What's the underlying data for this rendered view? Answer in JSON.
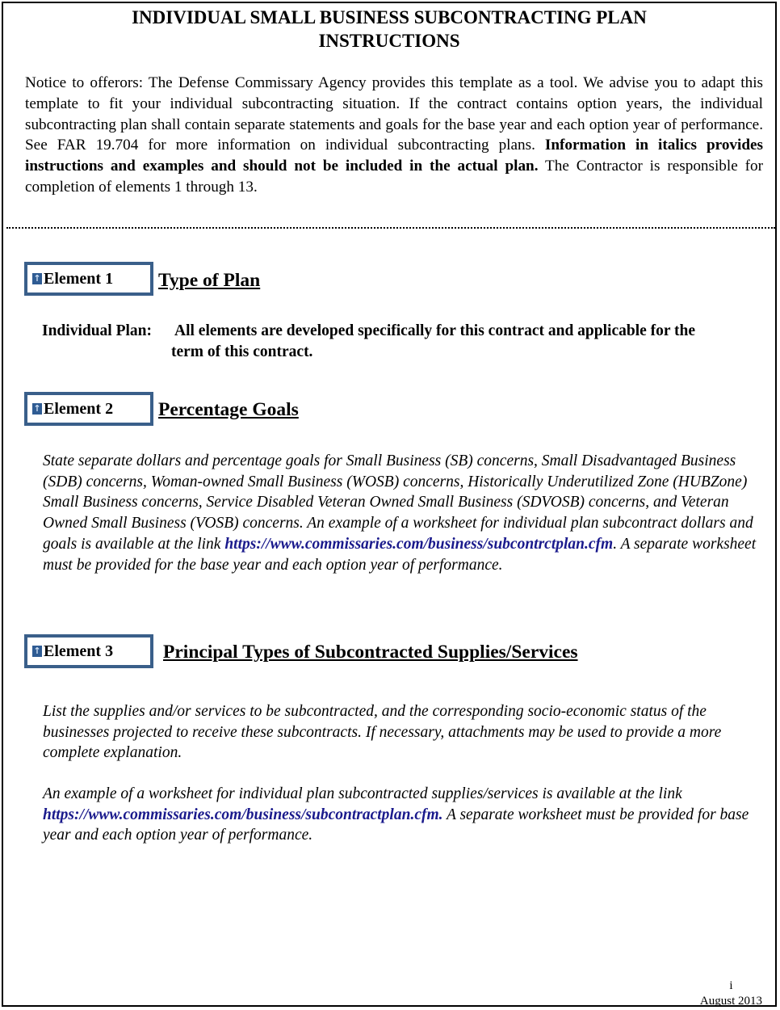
{
  "document": {
    "title_line1": "INDIVIDUAL SMALL BUSINESS  SUBCONTRACTING PLAN",
    "title_line2": "INSTRUCTIONS",
    "notice": {
      "text1": "Notice to offerors:  The Defense Commissary Agency provides this template as a tool.  We advise you to adapt this template to fit your individual subcontracting situation. If the contract contains option years, the individual subcontracting plan shall contain separate statements and goals for the base year and each option year of performance.  See FAR 19.704 for more information on individual subcontracting plans. ",
      "bold": "Information in italics provides instructions and examples and should not be included in the actual plan.",
      "text2": "  The Contractor is responsible for completion of elements 1 through 13."
    },
    "elements": [
      {
        "label": "Element 1",
        "heading": "Type of Plan",
        "plan_label": "Individual Plan:",
        "plan_text_line1": "All elements are developed specifically for this contract and applicable for the",
        "plan_text_line2": "term of this contract."
      },
      {
        "label": "Element 2",
        "heading": "Percentage Goals",
        "para_before_link": "State separate dollars and  percentage goals for Small Business (SB) concerns, Small Disadvantaged Business (SDB) concerns, Woman-owned Small Business (WOSB) concerns, Historically Underutilized  Zone (HUBZone) Small Business concerns, Service Disabled Veteran Owned Small Business (SDVOSB) concerns, and Veteran Owned Small Business (VOSB) concerns.  An example of a worksheet for individual plan subcontract dollars and goals is available at the link ",
        "link": "https://www.commissaries.com/business/subcontrctplan.cfm",
        "para_after_link": ".  A separate worksheet must be provided for the base year and each option year of performance."
      },
      {
        "label": "Element 3",
        "heading": "Principal Types of Subcontracted Supplies/Services",
        "para1": "List the supplies and/or services to be subcontracted, and the corresponding socio-economic status of the businesses projected to receive these subcontracts.  If necessary, attachments may be used to provide a more complete explanation.",
        "para2_before_link": "An example of a worksheet for individual plan subcontracted supplies/services is available at the link ",
        "link": "https://www.commissaries.com/business/subcontractplan.cfm.",
        "para2_after_link": "  A separate worksheet must be provided for base year and each option year of performance."
      }
    ],
    "footer": {
      "page_number": "i",
      "date": "August 2013"
    }
  }
}
